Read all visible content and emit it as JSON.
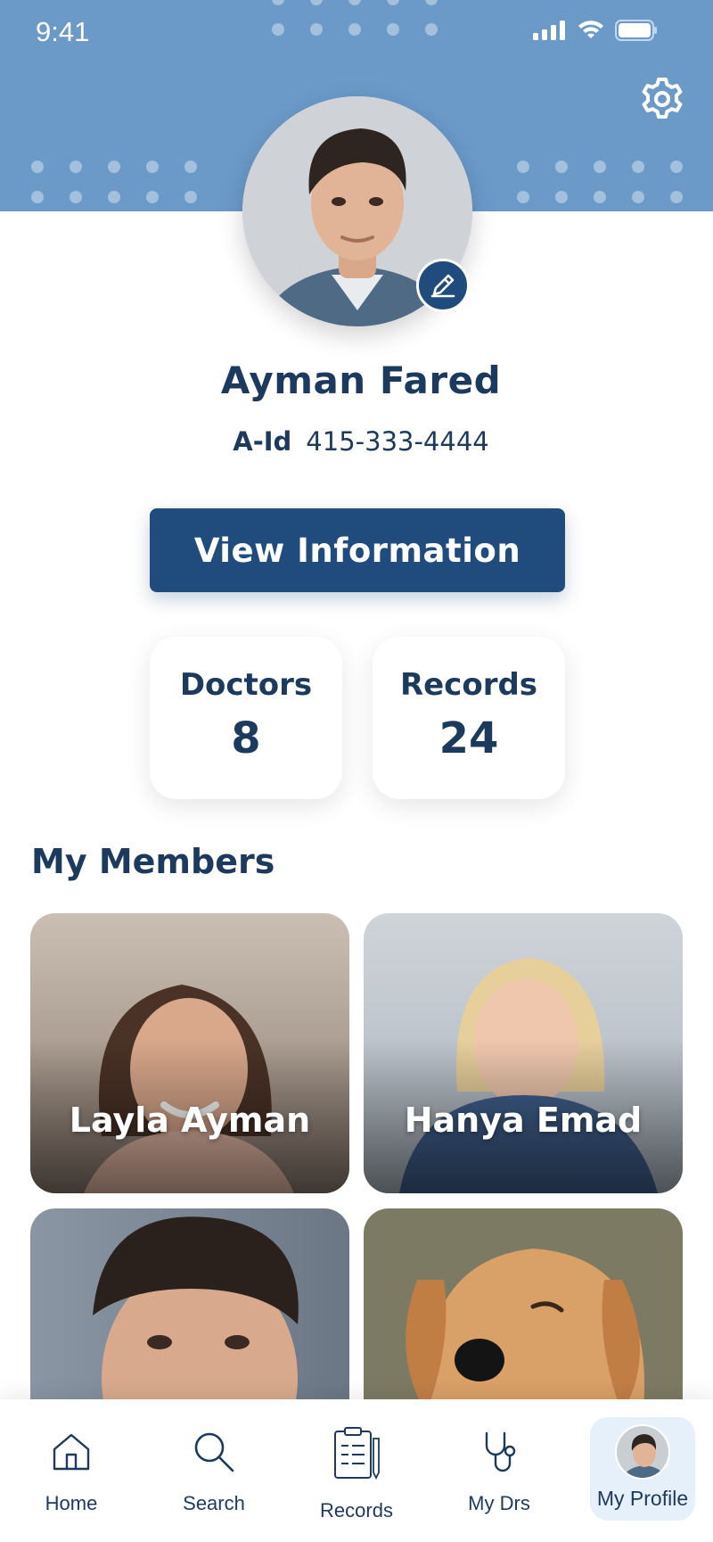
{
  "status_bar": {
    "time": "9:41"
  },
  "profile": {
    "name": "Ayman Fared",
    "id_label": "A-Id",
    "id_value": "415-333-4444",
    "view_button": "View Information"
  },
  "stats": [
    {
      "label": "Doctors",
      "value": "8"
    },
    {
      "label": "Records",
      "value": "24"
    }
  ],
  "members": {
    "title": "My Members",
    "items": [
      {
        "name": "Layla Ayman"
      },
      {
        "name": "Hanya Emad"
      },
      {
        "name": ""
      },
      {
        "name": ""
      }
    ]
  },
  "tabbar": {
    "items": [
      {
        "label": "Home",
        "icon": "home-icon"
      },
      {
        "label": "Search",
        "icon": "search-icon"
      },
      {
        "label": "Records",
        "icon": "clipboard-icon"
      },
      {
        "label": "My Drs",
        "icon": "stethoscope-icon"
      },
      {
        "label": "My Profile",
        "icon": "avatar"
      }
    ],
    "active": "My Profile"
  },
  "colors": {
    "header": "#6b9ac9",
    "primary": "#1f4b7d",
    "text": "#1c3a5e",
    "active_tab_bg": "#e6f0fa"
  }
}
